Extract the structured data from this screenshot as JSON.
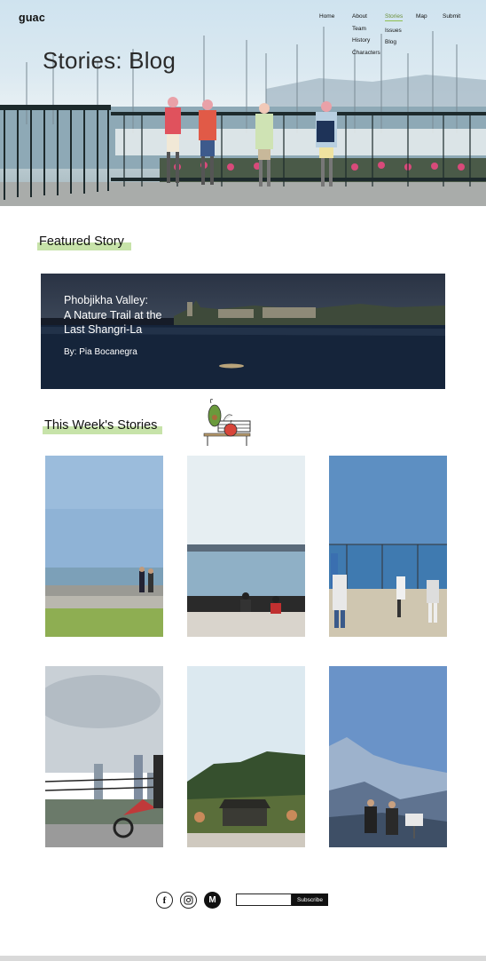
{
  "brand": {
    "logo": "guac"
  },
  "header": {
    "page_title": "Stories: Blog",
    "nav": {
      "home": "Home",
      "about": {
        "label": "About",
        "sub": [
          "Team",
          "History",
          "Characters"
        ]
      },
      "stories": {
        "label": "Stories",
        "sub": [
          "Issues",
          "Blog"
        ],
        "active": true
      },
      "map": "Map",
      "submit": "Submit"
    }
  },
  "featured": {
    "heading": "Featured Story",
    "title": "Phobjikha Valley:\nA Nature Trail at the\nLast Shangri-La",
    "author": "By: Pia Bocanegra"
  },
  "weekly": {
    "heading": "This Week's Stories",
    "mascot": "avocado-mascot-on-bench"
  },
  "stories": [
    {
      "image": "lakeside-walkers-photo"
    },
    {
      "image": "lake-view-bench-photo"
    },
    {
      "image": "lake-fence-people-photo"
    },
    {
      "image": "city-skyline-scooter-photo"
    },
    {
      "image": "forest-gate-photo"
    },
    {
      "image": "mountain-hikers-photo"
    }
  ],
  "footer": {
    "social_icons": [
      "facebook-icon",
      "instagram-icon",
      "medium-icon"
    ],
    "subscribe_placeholder": "",
    "subscribe_label": "Subscribe"
  },
  "colors": {
    "accent_highlight": "#c7e3a9",
    "active_nav": "#6b8f3a"
  }
}
